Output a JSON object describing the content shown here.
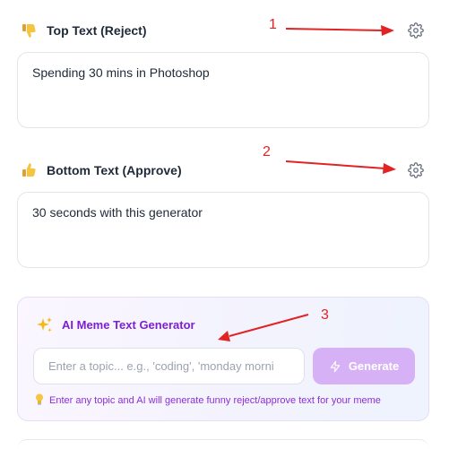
{
  "top_section": {
    "icon": "thumbs-down-emoji",
    "emoji": "👎",
    "label": "Top Text (Reject)",
    "settings_icon": "gear-icon",
    "value": "Spending 30 mins in Photoshop"
  },
  "bottom_section": {
    "icon": "thumbs-up-emoji",
    "emoji": "👍",
    "label": "Bottom Text (Approve)",
    "settings_icon": "gear-icon",
    "value": "30 seconds with this generator"
  },
  "ai_generator": {
    "icon": "sparkles-icon",
    "title": "AI Meme Text Generator",
    "input_placeholder": "Enter a topic... e.g., 'coding', 'monday morni",
    "input_value": "",
    "button_label": "Generate",
    "hint_icon": "lightbulb-icon",
    "hint": "Enter any topic and AI will generate funny reject/approve text for your meme"
  },
  "annotations": {
    "color": "#e02424",
    "markers": [
      "1",
      "2",
      "3"
    ]
  },
  "colors": {
    "accent": "#7c1fd1",
    "button_disabled": "#d7b1f5"
  }
}
